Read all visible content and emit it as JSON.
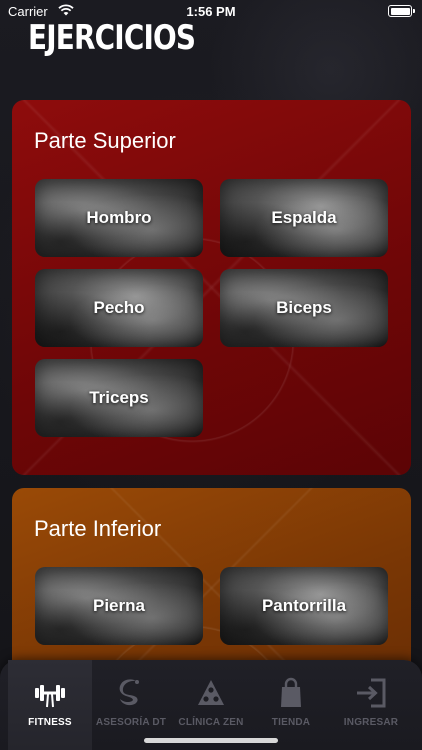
{
  "status_bar": {
    "carrier": "Carrier",
    "time": "1:56 PM"
  },
  "page": {
    "title": "EJERCICIOS"
  },
  "sections": [
    {
      "title": "Parte Superior",
      "color": "#8e0c0c",
      "exercises": [
        "Hombro",
        "Espalda",
        "Pecho",
        "Biceps",
        "Triceps"
      ]
    },
    {
      "title": "Parte Inferior",
      "color": "#9a4a06",
      "exercises": [
        "Pierna",
        "Pantorrilla"
      ]
    }
  ],
  "tab_bar": {
    "items": [
      {
        "label": "FITNESS",
        "icon": "dumbbell-icon",
        "active": true
      },
      {
        "label": "ASESORÍA DT",
        "icon": "dragon-icon",
        "active": false
      },
      {
        "label": "CLÍNICA ZEN",
        "icon": "lotus-icon",
        "active": false
      },
      {
        "label": "TIENDA",
        "icon": "shopping-bag-icon",
        "active": false
      },
      {
        "label": "INGRESAR",
        "icon": "login-icon",
        "active": false
      }
    ]
  }
}
